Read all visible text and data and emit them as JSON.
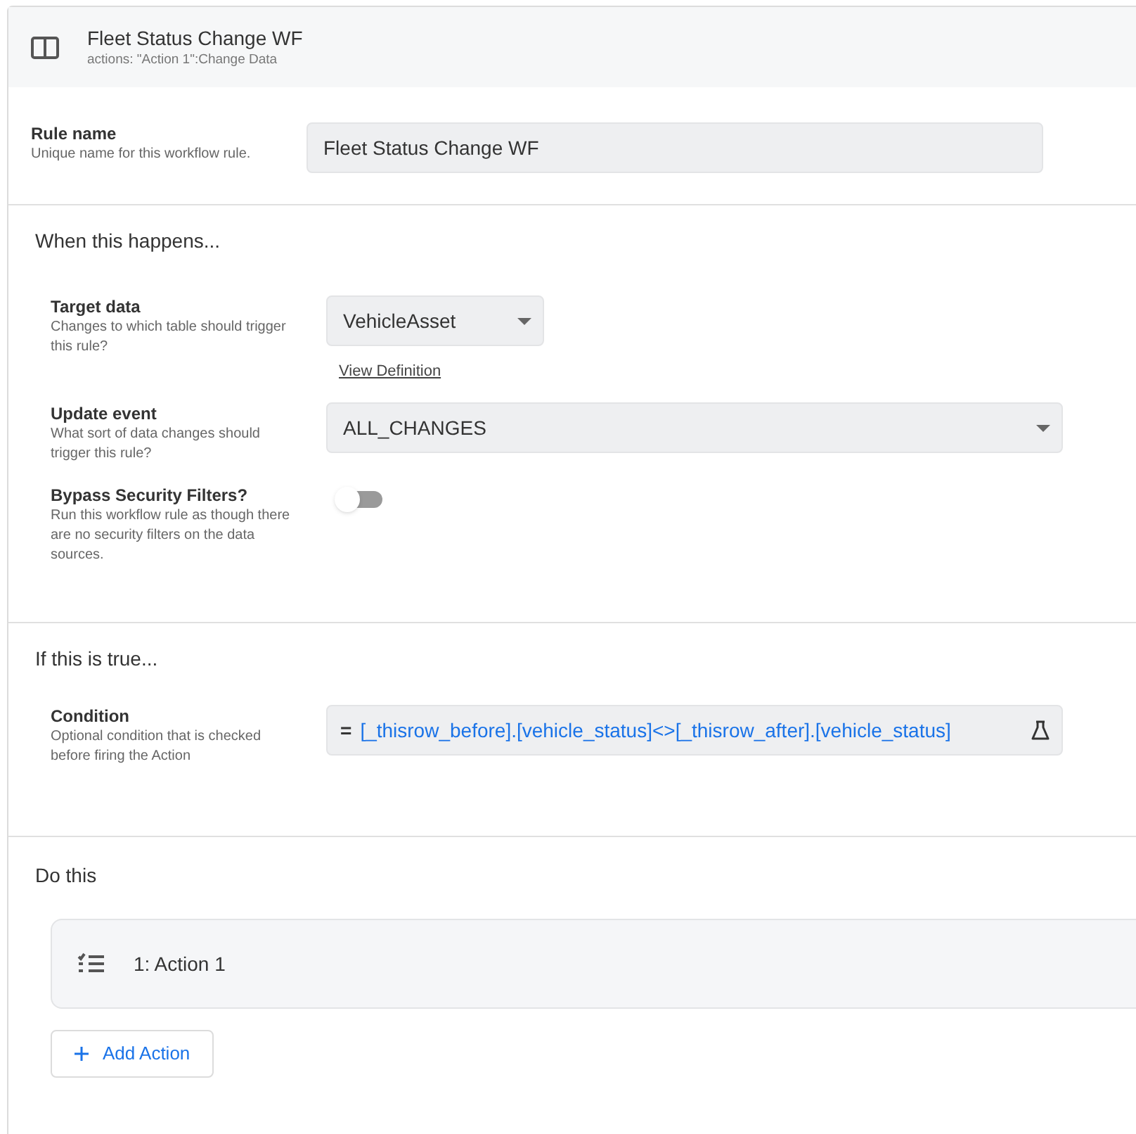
{
  "header": {
    "title": "Fleet Status Change WF",
    "subtitle": "actions: \"Action 1\":Change Data"
  },
  "rule_name": {
    "label": "Rule name",
    "hint": "Unique name for this workflow rule.",
    "value": "Fleet Status Change WF"
  },
  "when_section": {
    "heading": "When this happens...",
    "fields": [
      {
        "kind": "select",
        "label": "Target data",
        "hint": "Changes to which table should trigger this rule?",
        "value": "VehicleAsset",
        "link": "View Definition",
        "wide": false
      },
      {
        "kind": "select",
        "label": "Update event",
        "hint": "What sort of data changes should trigger this rule?",
        "value": "ALL_CHANGES",
        "wide": true
      },
      {
        "kind": "toggle",
        "label": "Bypass Security Filters?",
        "hint": "Run this workflow rule as though there are no security filters on the data sources.",
        "on": false
      }
    ]
  },
  "if_section": {
    "heading": "If this is true...",
    "condition": {
      "label": "Condition",
      "hint": "Optional condition that is checked before firing the Action",
      "prefix": "=",
      "expression": "[_thisrow_before].[vehicle_status]<>[_thisrow_after].[vehicle_status]"
    }
  },
  "do_section": {
    "heading": "Do this",
    "actions": [
      "1: Action 1"
    ],
    "add_button": "Add Action"
  }
}
